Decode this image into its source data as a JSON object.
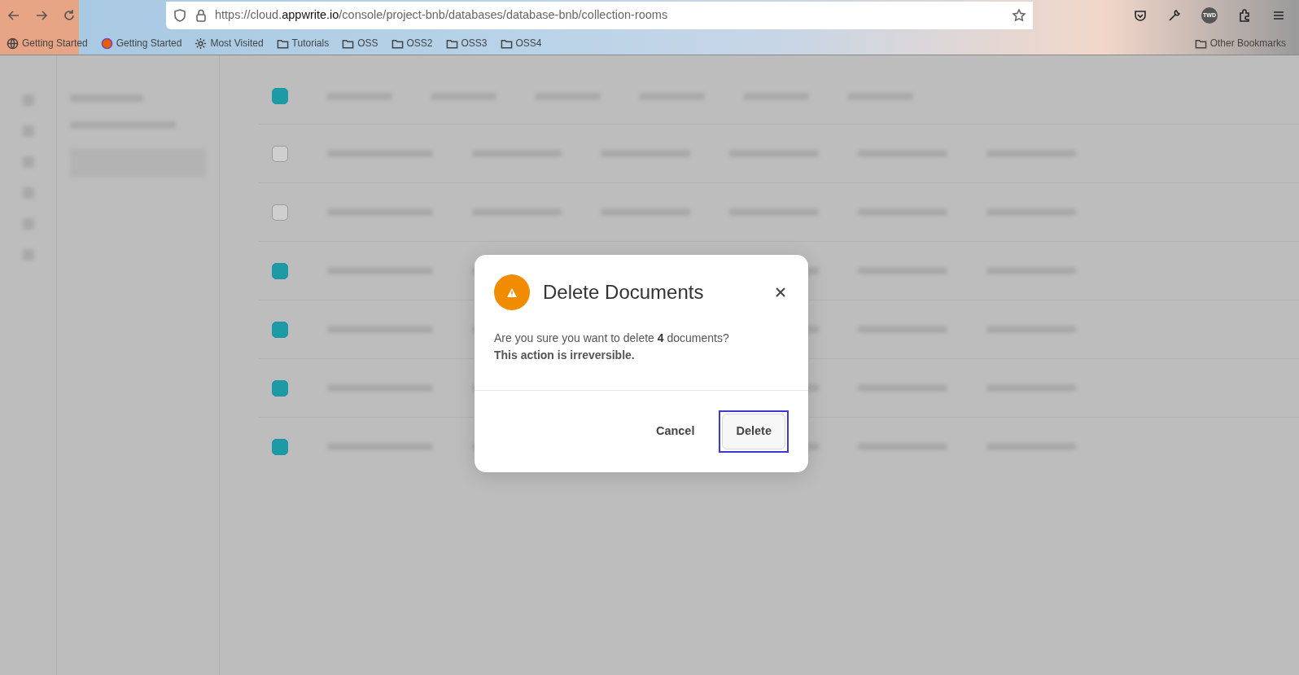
{
  "browser": {
    "url": "https://cloud.**appwrite.io**/console/project-bnb/databases/database-bnb/collection-rooms",
    "profile_badge": "TWD",
    "bookmarks": [
      {
        "kind": "globe",
        "label": "Getting Started"
      },
      {
        "kind": "firefox",
        "label": "Getting Started"
      },
      {
        "kind": "gear",
        "label": "Most Visited"
      },
      {
        "kind": "folder",
        "label": "Tutorials"
      },
      {
        "kind": "folder",
        "label": "OSS"
      },
      {
        "kind": "folder",
        "label": "OSS2"
      },
      {
        "kind": "folder",
        "label": "OSS3"
      },
      {
        "kind": "folder",
        "label": "OSS4"
      }
    ],
    "other_bookmarks": "Other Bookmarks"
  },
  "background": {
    "header_checked": true,
    "rows": [
      {
        "checked": false
      },
      {
        "checked": false
      },
      {
        "checked": true
      },
      {
        "checked": true
      },
      {
        "checked": true
      },
      {
        "checked": true
      }
    ]
  },
  "dialog": {
    "title": "Delete Documents",
    "message": "Are you sure you want to delete **4** documents?",
    "warning": "This action is irreversible.",
    "buttons": [
      {
        "kind": "text",
        "label": "Cancel",
        "focused": false
      },
      {
        "kind": "outline",
        "label": "Delete",
        "focused": true
      }
    ]
  }
}
